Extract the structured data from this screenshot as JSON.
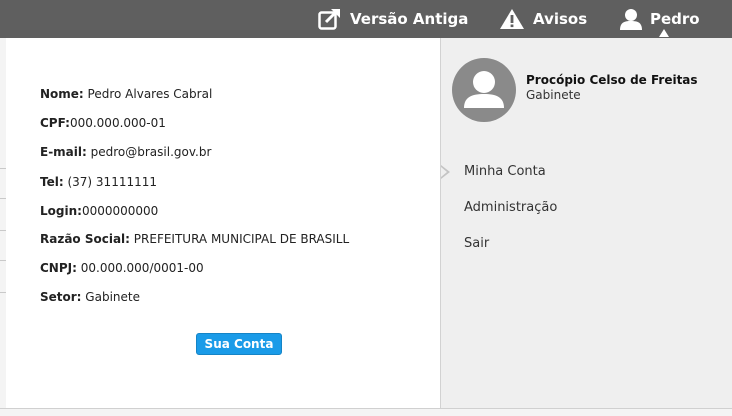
{
  "topbar": {
    "versao_antiga": "Versão Antiga",
    "avisos": "Avisos",
    "user": "Pedro"
  },
  "info": {
    "rows": [
      {
        "label": "Nome:",
        "value": " Pedro Alvares Cabral"
      },
      {
        "label": "CPF:",
        "value": "000.000.000-01"
      },
      {
        "label": "E-mail:",
        "value": " pedro@brasil.gov.br"
      },
      {
        "label": "Tel:",
        "value": " (37) 31111111"
      },
      {
        "label": "Login:",
        "value": "0000000000"
      },
      {
        "label": "Razão Social:",
        "value": " PREFEITURA MUNICIPAL DE BRASILL"
      },
      {
        "label": "CNPJ:",
        "value": " 00.000.000/0001-00"
      },
      {
        "label": "Setor:",
        "value": " Gabinete"
      }
    ],
    "button_label": "Sua Conta"
  },
  "profile": {
    "name": "Procópio Celso de Freitas",
    "role": "Gabinete"
  },
  "menu": {
    "items": [
      "Minha Conta",
      "Administração",
      "Sair"
    ]
  }
}
